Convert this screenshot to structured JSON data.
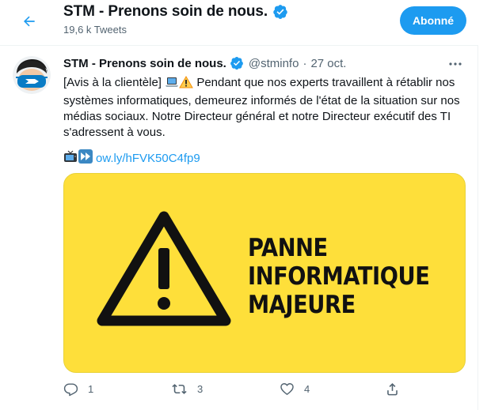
{
  "header": {
    "title": "STM - Prenons soin de nous.",
    "tweet_count": "19,6 k Tweets",
    "follow_label": "Abonné"
  },
  "tweet": {
    "author_name": "STM - Prenons soin de nous.",
    "handle": "@stminfo",
    "separator": "·",
    "date": "27 oct.",
    "text_before_emoji": "[Avis à la clientèle]",
    "text_after_emoji": "Pendant que nos experts travaillent à rétablir nos systèmes informatiques, demeurez informés de l'état de la situation sur nos médias sociaux. Notre Directeur général et notre Directeur exécutif des TI s'adressent à vous.",
    "link": "ow.ly/hFVK50C4fp9",
    "media": {
      "line1": "PANNE",
      "line2": "INFORMATIQUE",
      "line3": "MAJEURE",
      "background_color": "#fedf3a"
    },
    "reply_count": "1",
    "retweet_count": "3",
    "like_count": "4"
  },
  "colors": {
    "accent": "#1d9bf0",
    "secondary_text": "#536471",
    "primary_text": "#0f1419"
  },
  "icons": {
    "back": "arrow-left-icon",
    "verified": "verified-badge-icon",
    "more": "more-horizontal-icon",
    "reply": "reply-icon",
    "retweet": "retweet-icon",
    "like": "heart-icon",
    "share": "share-icon"
  }
}
